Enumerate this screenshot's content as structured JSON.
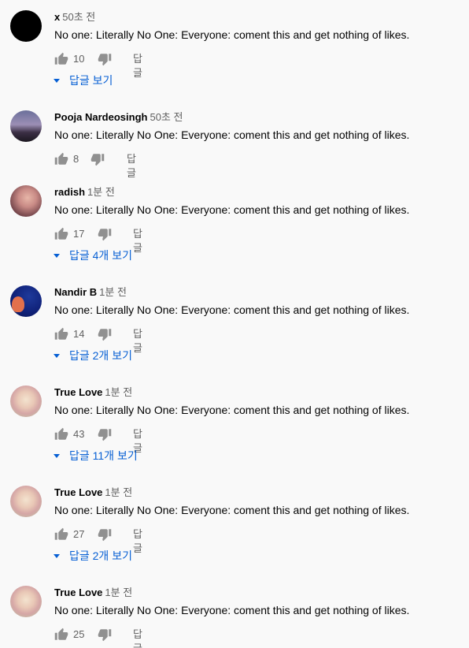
{
  "comments": [
    {
      "author": "x",
      "time": "50초 전",
      "text": "No one: Literally No One: Everyone: coment this and get nothing of likes.",
      "likes": "10",
      "reply_label": "답글",
      "replies_label": "답글 보기",
      "avatar_icon": "black-circle-avatar"
    },
    {
      "author": "Pooja Nardeosingh",
      "time": "50초 전",
      "text": "No one: Literally No One: Everyone: coment this and get nothing of likes.",
      "likes": "8",
      "reply_label": "답글",
      "avatar_icon": "dusk-landscape-avatar"
    },
    {
      "author": "radish",
      "time": "1분 전",
      "text": "No one: Literally No One: Everyone: coment this and get nothing of likes.",
      "likes": "17",
      "reply_label": "답글",
      "replies_label": "답글 4개 보기",
      "avatar_icon": "portrait-avatar"
    },
    {
      "author": "Nandir B",
      "time": "1분 전",
      "text": "No one: Literally No One: Everyone: coment this and get nothing of likes.",
      "likes": "14",
      "reply_label": "답글",
      "replies_label": "답글 2개 보기",
      "avatar_icon": "blue-illustration-avatar"
    },
    {
      "author": "True Love",
      "time": "1분 전",
      "text": "No one: Literally No One: Everyone: coment this and get nothing of likes.",
      "likes": "43",
      "reply_label": "답글",
      "replies_label": "답글 11개 보기",
      "avatar_icon": "cat-avatar"
    },
    {
      "author": "True Love",
      "time": "1분 전",
      "text": "No one: Literally No One: Everyone: coment this and get nothing of likes.",
      "likes": "27",
      "reply_label": "답글",
      "replies_label": "답글 2개 보기",
      "avatar_icon": "cat-avatar"
    },
    {
      "author": "True Love",
      "time": "1분 전",
      "text": "No one: Literally No One: Everyone: coment this and get nothing of likes.",
      "likes": "25",
      "reply_label": "답글",
      "avatar_icon": "cat-avatar"
    }
  ],
  "colors": {
    "background": "#f9f9f9",
    "text": "#030303",
    "secondary": "#606060",
    "link": "#065fd4"
  }
}
